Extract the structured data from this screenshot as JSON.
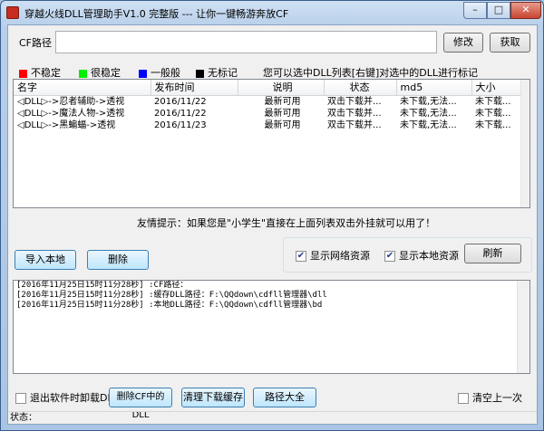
{
  "window": {
    "title": "穿越火线DLL管理助手V1.0 完整版 --- 让你一键畅游奔放CF",
    "minimize": "–",
    "maximize": "□",
    "close": "✕"
  },
  "cf_path": {
    "label": "CF路径",
    "value": "",
    "modify_button": "修改",
    "get_button": "获取"
  },
  "legend": {
    "items": [
      {
        "label": "不稳定",
        "color": "#ff0000"
      },
      {
        "label": "很稳定",
        "color": "#00ee00"
      },
      {
        "label": "一般般",
        "color": "#0000ff"
      },
      {
        "label": "无标记",
        "color": "#000000"
      }
    ],
    "hint": "您可以选中DLL列表[右键]对选中的DLL进行标记"
  },
  "dll_list": {
    "columns": [
      "名字",
      "发布时间",
      "说明",
      "状态",
      "md5",
      "大小"
    ],
    "rows": [
      [
        "◁DLL▷->忍者辅助->透视",
        "2016/11/22",
        "最新可用",
        "双击下载并...",
        "未下载,无法...",
        "未下载..."
      ],
      [
        "◁DLL▷->魔法人物->透视",
        "2016/11/22",
        "最新可用",
        "双击下载并...",
        "未下载,无法...",
        "未下载..."
      ],
      [
        "◁DLL▷->黑蝙蝠->透视",
        "2016/11/23",
        "最新可用",
        "双击下载并...",
        "未下载,无法...",
        "未下载..."
      ]
    ]
  },
  "tip": "友情提示：如果您是\"小学生\"直接在上面列表双击外挂就可以用了！",
  "actions": {
    "import_local": "导入本地",
    "delete": "删除",
    "show_network": "显示网络资源",
    "show_local": "显示本地资源",
    "refresh": "刷新",
    "show_network_checked": true,
    "show_local_checked": true
  },
  "log": [
    "[2016年11月25日15时11分28秒] :CF路径：",
    "[2016年11月25日15时11分28秒] :缓存DLL路径：F:\\QQdown\\cdfll管理器\\dll",
    "[2016年11月25日15时11分28秒] :本地DLL路径：F:\\QQdown\\cdfll管理器\\bd"
  ],
  "bottom": {
    "unload_on_exit": "退出软件时卸载DLL",
    "delete_cf_dll": "删除CF中的DLL",
    "clear_cache": "清理下载缓存",
    "path_all": "路径大全",
    "clear_previous": "清空上一次"
  },
  "status": {
    "text": "状态："
  }
}
